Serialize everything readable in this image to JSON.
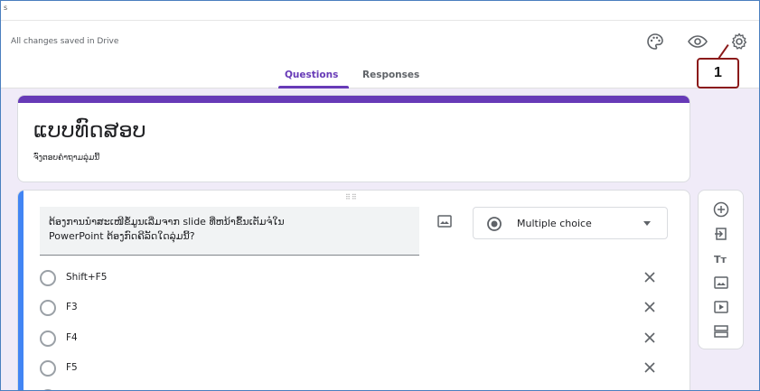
{
  "window": {
    "title_fragment": "s"
  },
  "header": {
    "status": "All changes saved in Drive",
    "icons": [
      "palette-icon",
      "eye-icon",
      "settings-icon"
    ]
  },
  "tabs": [
    {
      "label": "Questions",
      "active": true
    },
    {
      "label": "Responses",
      "active": false
    }
  ],
  "annotation": {
    "label": "1"
  },
  "form": {
    "title": "ແບບທົດສອບ",
    "description": "ຈົ່ງຕອບຄຳຖາມລຸ່ມນີ້"
  },
  "question": {
    "drag_handle": "⠿⠿",
    "text_line1": "ຕ້ອງການນຳສະເໜີຂໍ້ມູນເລີ່ມຈາກ slide ທີ່ຫນ້າຂຶ້ນເຕັມຈໍໃນ",
    "text_line2": "PowerPoint ຕ້ອງກົດຄີລັດໃດລຸ່ມນີ້?",
    "type_label": "Multiple choice",
    "options": [
      "Shift+F5",
      "F3",
      "F4",
      "F5"
    ]
  },
  "side_toolbar": {
    "tools": [
      "add-question-icon",
      "import-questions-icon",
      "add-title-icon",
      "add-image-icon",
      "add-video-icon",
      "add-section-icon"
    ]
  },
  "colors": {
    "accent": "#673ab7",
    "focus_bar": "#4285f4",
    "background": "#f0ebf8",
    "annotation": "#8b1a1a"
  }
}
